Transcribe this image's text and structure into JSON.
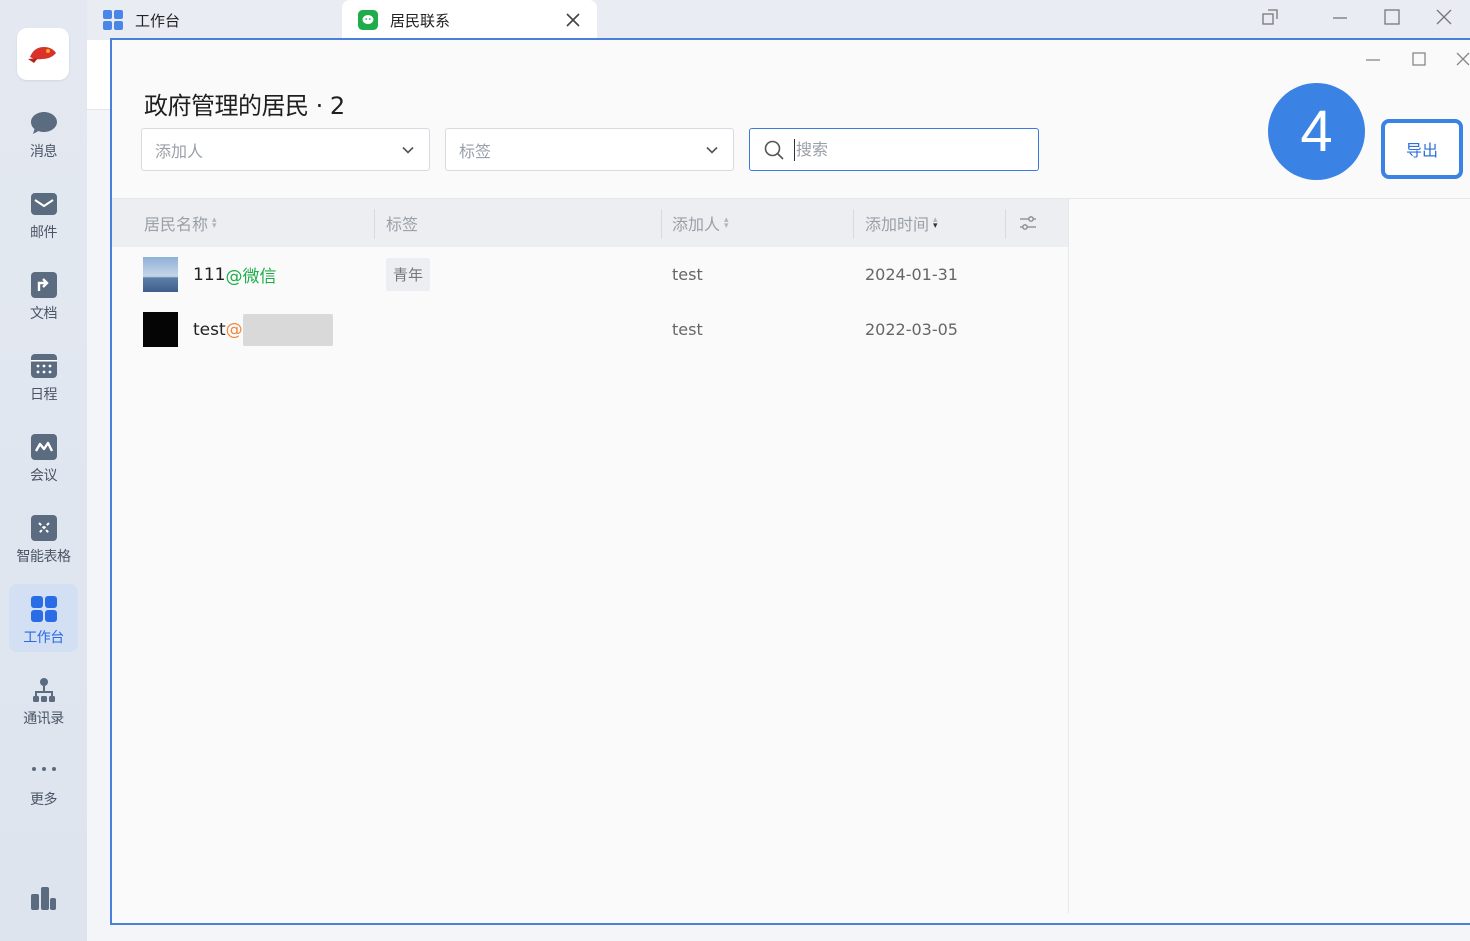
{
  "rail": {
    "items": [
      {
        "label": "消息",
        "icon": "chat-bubble-icon"
      },
      {
        "label": "邮件",
        "icon": "mail-icon"
      },
      {
        "label": "文档",
        "icon": "document-icon"
      },
      {
        "label": "日程",
        "icon": "calendar-icon"
      },
      {
        "label": "会议",
        "icon": "meeting-icon"
      },
      {
        "label": "智能表格",
        "icon": "smart-table-icon"
      },
      {
        "label": "工作台",
        "icon": "workbench-icon",
        "active": true
      },
      {
        "label": "通讯录",
        "icon": "contacts-icon"
      },
      {
        "label": "更多",
        "icon": "more-dots-icon"
      }
    ]
  },
  "tabs": [
    {
      "label": "工作台",
      "icon": "workbench-icon"
    },
    {
      "label": "居民联系",
      "icon": "wechat-icon",
      "active": true
    }
  ],
  "dialog": {
    "title": "政府管理的居民 · 2",
    "filters": {
      "adder_placeholder": "添加人",
      "tag_placeholder": "标签",
      "search_placeholder": "搜索"
    },
    "step_badge": "4",
    "export_label": "导出"
  },
  "table": {
    "headers": {
      "name": "居民名称",
      "tag": "标签",
      "adder": "添加人",
      "time": "添加时间"
    },
    "rows": [
      {
        "name": "111",
        "suffix": "@微信",
        "tag": "青年",
        "adder": "test",
        "time": "2024-01-31"
      },
      {
        "name": "test",
        "suffix": "@",
        "tag": "",
        "adder": "test",
        "time": "2022-03-05"
      }
    ]
  },
  "colors": {
    "accent": "#3a82e4",
    "wechat_green": "#1fad4c",
    "at_orange": "#f0883e"
  }
}
